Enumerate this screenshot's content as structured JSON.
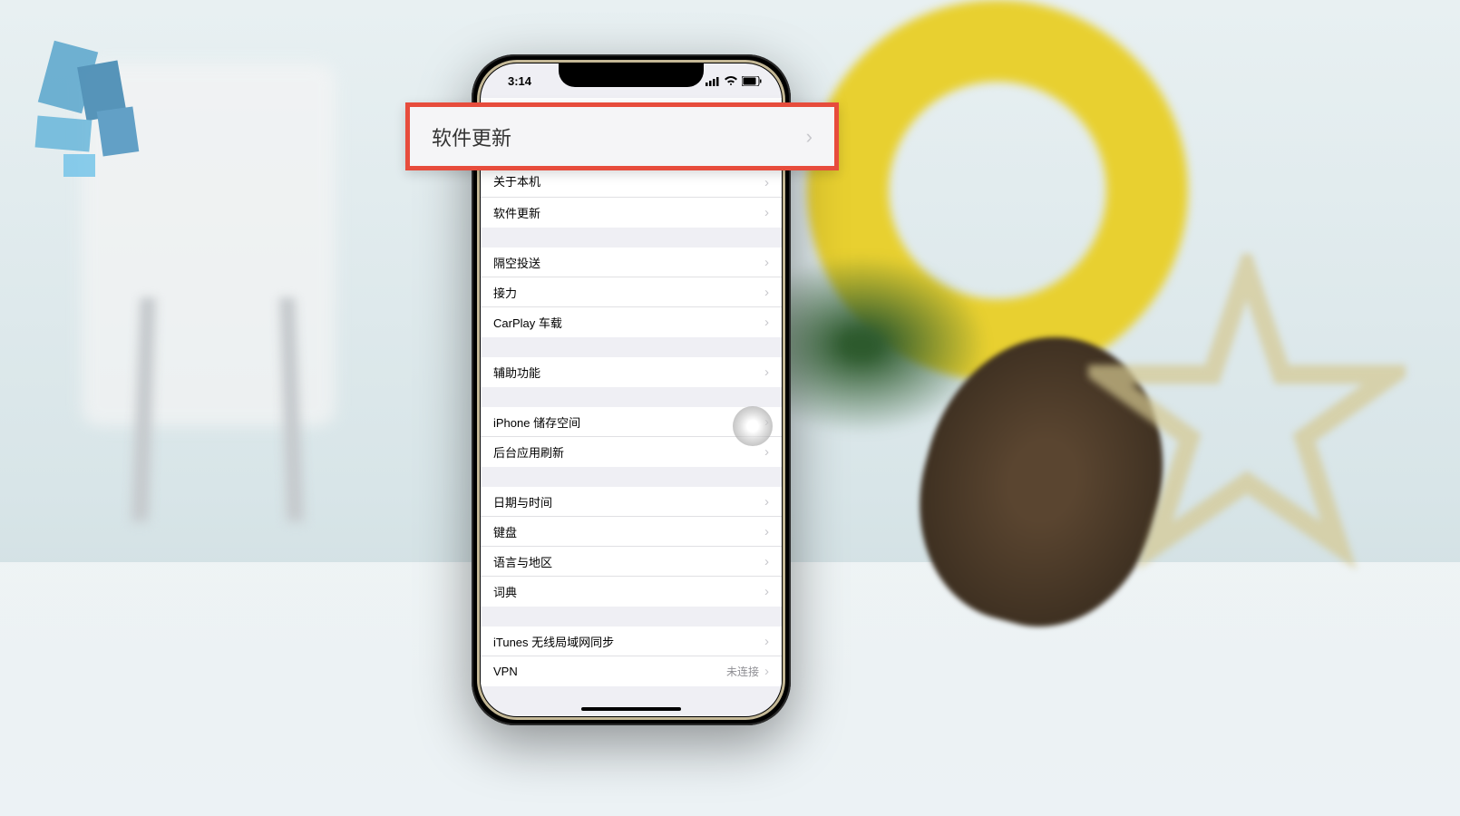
{
  "status_bar": {
    "time": "3:14"
  },
  "callout": {
    "label": "软件更新"
  },
  "settings": {
    "group1": {
      "about": "关于本机",
      "software_update": "软件更新"
    },
    "group2": {
      "airdrop": "隔空投送",
      "handoff": "接力",
      "carplay": "CarPlay 车载"
    },
    "group3": {
      "accessibility": "辅助功能"
    },
    "group4": {
      "storage": "iPhone 储存空间",
      "background_refresh": "后台应用刷新"
    },
    "group5": {
      "date_time": "日期与时间",
      "keyboard": "键盘",
      "language_region": "语言与地区",
      "dictionary": "词典"
    },
    "group6": {
      "itunes_sync": "iTunes 无线局域网同步",
      "vpn": "VPN",
      "vpn_status": "未连接"
    }
  }
}
